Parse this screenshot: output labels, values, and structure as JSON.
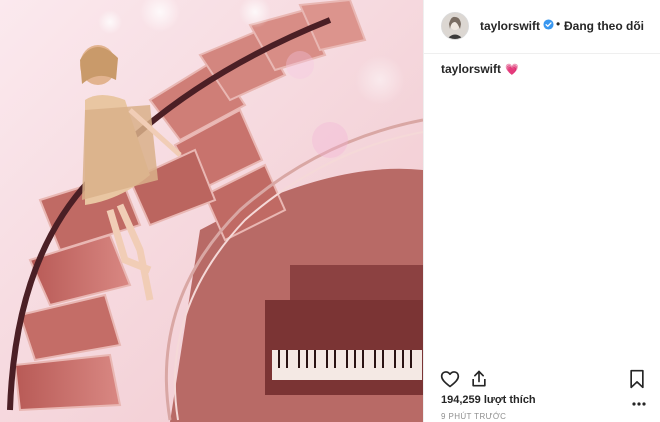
{
  "post": {
    "username": "taylorswift",
    "verified": true,
    "separator": "•",
    "follow_state": "Đang theo dõi",
    "caption_user": "taylorswift",
    "caption_emoji": "💗",
    "likes": "194,259 lượt thích",
    "time": "9 PHÚT TRƯỚC"
  },
  "photo": {
    "description_icon": "staircase-photo"
  },
  "icons": {
    "like": "heart-icon",
    "share": "share-icon",
    "save": "bookmark-icon",
    "more": "more-icon",
    "verified": "verified-badge-icon"
  },
  "colors": {
    "verified_blue": "#3897f0",
    "text": "#262626",
    "muted": "#8e8e8e",
    "divider": "#efefef"
  }
}
